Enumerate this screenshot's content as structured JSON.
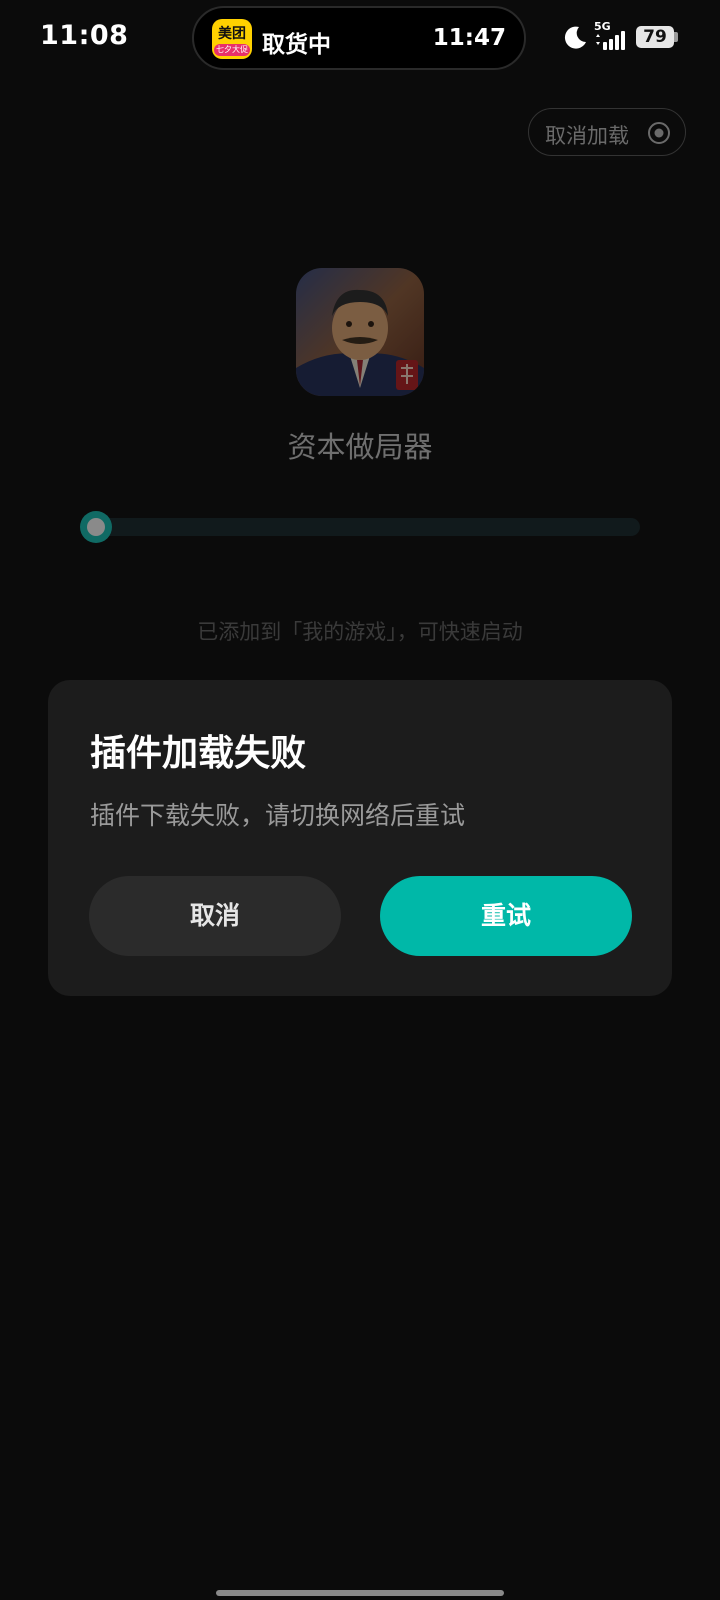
{
  "status_bar": {
    "time": "11:08",
    "network_type": "5G",
    "battery": "79"
  },
  "live_activity": {
    "app_name_top": "美团",
    "app_name_bottom": "七夕大促",
    "status": "取货中",
    "time": "11:47"
  },
  "loader": {
    "cancel_label": "取消加载",
    "game_name": "资本做局器",
    "progress": 0,
    "added_hint": "已添加到「我的游戏」，可快速启动"
  },
  "dialog": {
    "title": "插件加载失败",
    "message": "插件下载失败，请切换网络后重试",
    "cancel_label": "取消",
    "retry_label": "重试"
  },
  "colors": {
    "accent": "#00b8a8",
    "background": "#0b0b0b",
    "dialog_bg": "#1c1c1c"
  },
  "icons": [
    "moon-icon",
    "signal-icon",
    "battery-icon",
    "record-icon",
    "game-app-icon",
    "meituan-app-icon"
  ]
}
